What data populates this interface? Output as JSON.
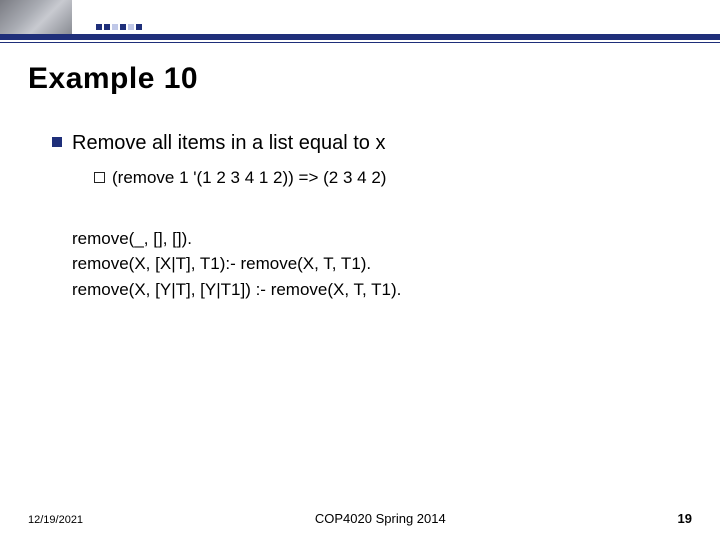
{
  "slide": {
    "title": "Example 10",
    "bullet1": "Remove all items in a list equal to x",
    "bullet2": "(remove 1 '(1 2 3 4 1 2)) => (2 3 4 2)",
    "code": {
      "l1": "remove(_, [], []).",
      "l2": "remove(X, [X|T], T1):- remove(X, T, T1).",
      "l3": "remove(X, [Y|T], [Y|T1]) :- remove(X, T, T1)."
    }
  },
  "footer": {
    "date": "12/19/2021",
    "course": "COP4020 Spring 2014",
    "page": "19"
  }
}
